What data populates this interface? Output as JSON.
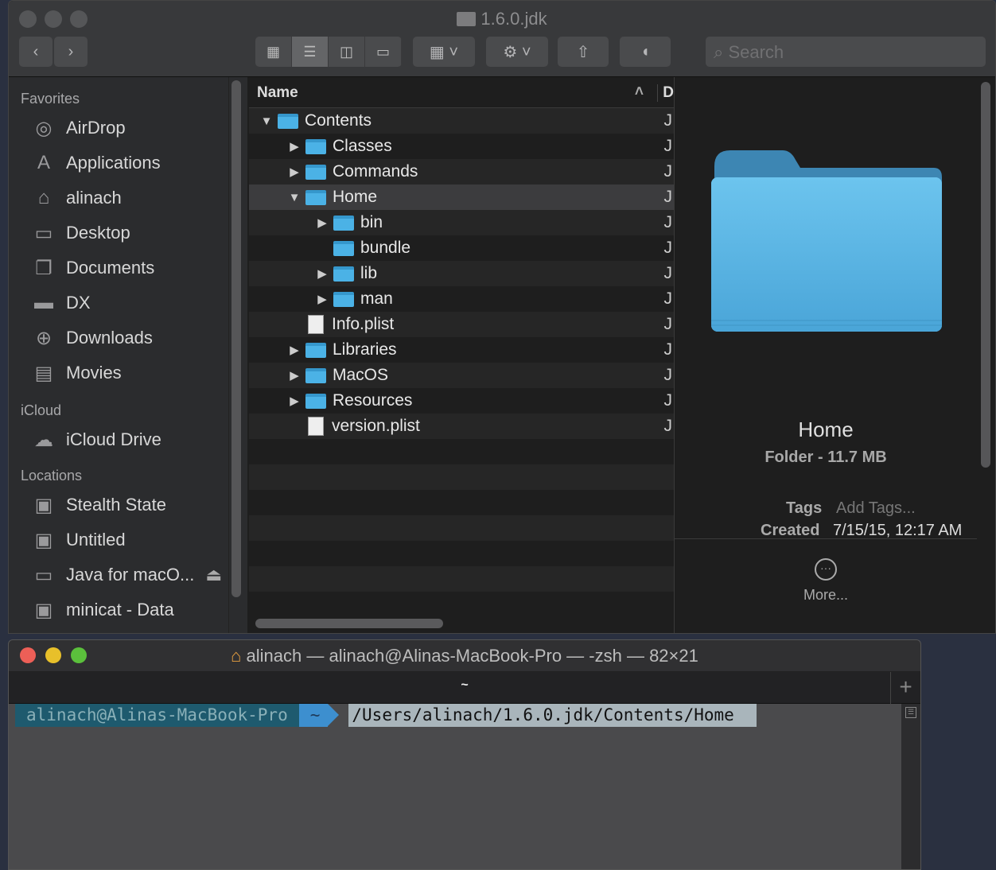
{
  "finder": {
    "title": "1.6.0.jdk",
    "search_placeholder": "Search",
    "sidebar": {
      "favorites_label": "Favorites",
      "favorites": [
        {
          "label": "AirDrop",
          "icon": "airdrop-icon"
        },
        {
          "label": "Applications",
          "icon": "applications-icon"
        },
        {
          "label": "alinach",
          "icon": "home-icon"
        },
        {
          "label": "Desktop",
          "icon": "desktop-icon"
        },
        {
          "label": "Documents",
          "icon": "documents-icon"
        },
        {
          "label": "DX",
          "icon": "folder-icon"
        },
        {
          "label": "Downloads",
          "icon": "downloads-icon"
        },
        {
          "label": "Movies",
          "icon": "movies-icon"
        }
      ],
      "icloud_label": "iCloud",
      "icloud": [
        {
          "label": "iCloud Drive",
          "icon": "cloud-icon"
        }
      ],
      "locations_label": "Locations",
      "locations": [
        {
          "label": "Stealth State",
          "icon": "disk-icon"
        },
        {
          "label": "Untitled",
          "icon": "disk-icon"
        },
        {
          "label": "Java for macO...",
          "icon": "disk-icon",
          "eject": true
        },
        {
          "label": "minicat - Data",
          "icon": "disk-icon"
        }
      ]
    },
    "list": {
      "column_name": "Name",
      "column_next": "D",
      "rows": [
        {
          "name": "Contents",
          "level": 0,
          "type": "folder",
          "disclosure": "open",
          "col": "J"
        },
        {
          "name": "Classes",
          "level": 1,
          "type": "folder",
          "disclosure": "closed",
          "col": "J"
        },
        {
          "name": "Commands",
          "level": 1,
          "type": "folder",
          "disclosure": "closed",
          "col": "J"
        },
        {
          "name": "Home",
          "level": 1,
          "type": "folder",
          "disclosure": "open",
          "selected": true,
          "col": "J"
        },
        {
          "name": "bin",
          "level": 2,
          "type": "folder",
          "disclosure": "closed",
          "col": "J"
        },
        {
          "name": "bundle",
          "level": 2,
          "type": "alias",
          "disclosure": "none",
          "col": "J"
        },
        {
          "name": "lib",
          "level": 2,
          "type": "folder",
          "disclosure": "closed",
          "col": "J"
        },
        {
          "name": "man",
          "level": 2,
          "type": "folder",
          "disclosure": "closed",
          "col": "J"
        },
        {
          "name": "Info.plist",
          "level": 1,
          "type": "file",
          "disclosure": "none",
          "col": "J"
        },
        {
          "name": "Libraries",
          "level": 1,
          "type": "folder",
          "disclosure": "closed",
          "col": "J"
        },
        {
          "name": "MacOS",
          "level": 1,
          "type": "folder",
          "disclosure": "closed",
          "col": "J"
        },
        {
          "name": "Resources",
          "level": 1,
          "type": "folder",
          "disclosure": "closed",
          "col": "J"
        },
        {
          "name": "version.plist",
          "level": 1,
          "type": "file",
          "disclosure": "none",
          "col": "J"
        }
      ]
    },
    "preview": {
      "name": "Home",
      "kind": "Folder - 11.7 MB",
      "tags_label": "Tags",
      "tags_value": "Add Tags...",
      "created_label": "Created",
      "created_value": "7/15/15, 12:17 AM",
      "more_label": "More..."
    }
  },
  "terminal": {
    "title": "alinach — alinach@Alinas-MacBook-Pro — -zsh — 82×21",
    "tab": "~",
    "prompt_user": "alinach@Alinas-MacBook-Pro",
    "prompt_dir": "~",
    "input": "/Users/alinach/1.6.0.jdk/Contents/Home"
  }
}
